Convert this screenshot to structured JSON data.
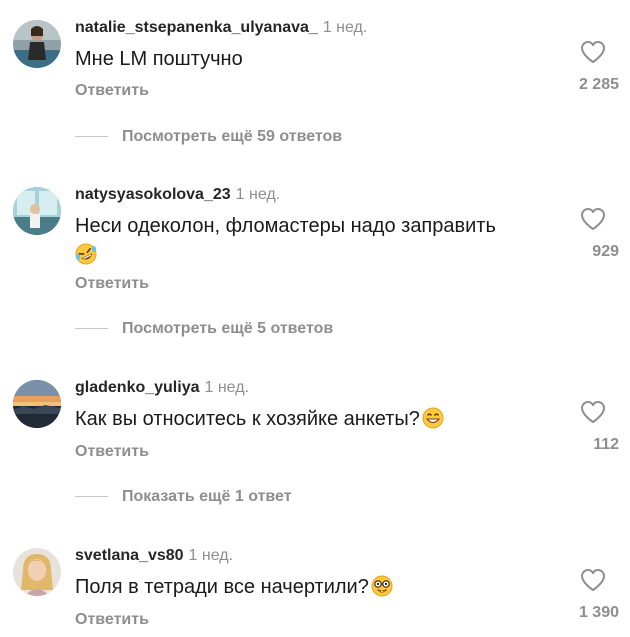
{
  "comments": [
    {
      "username": "natalie_stsepanenka_ulyanava_",
      "time": "1 нед.",
      "text": "Мне LM поштучно",
      "emoji": "",
      "reply_label": "Ответить",
      "likes": "2 285",
      "more_replies": "Посмотреть ещё 59 ответов",
      "avatar": "woman-by-pool-avatar"
    },
    {
      "username": "natysyasokolova_23",
      "time": "1 нед.",
      "text": "Неси одеколон,  фломастеры надо заправить",
      "emoji": "rolling-on-floor-laughing-emoji",
      "reply_label": "Ответить",
      "likes": "929",
      "more_replies": "Посмотреть ещё 5 ответов",
      "avatar": "child-at-window-avatar"
    },
    {
      "username": "gladenko_yuliya",
      "time": "1 нед.",
      "text": "Как вы относитесь к хозяйке анкеты?",
      "emoji": "grinning-face-emoji",
      "reply_label": "Ответить",
      "likes": "112",
      "more_replies": "Показать ещё 1 ответ",
      "avatar": "sunset-landscape-avatar"
    },
    {
      "username": "svetlana_vs80",
      "time": "1 нед.",
      "text": "Поля в тетради все начертили?",
      "emoji": "nerd-face-emoji",
      "reply_label": "Ответить",
      "likes": "1 390",
      "more_replies": "",
      "avatar": "blonde-woman-avatar"
    }
  ],
  "colors": {
    "text": "#262626",
    "secondary": "#8e8e8e",
    "divider": "#c7c7c7",
    "background": "#ffffff"
  }
}
